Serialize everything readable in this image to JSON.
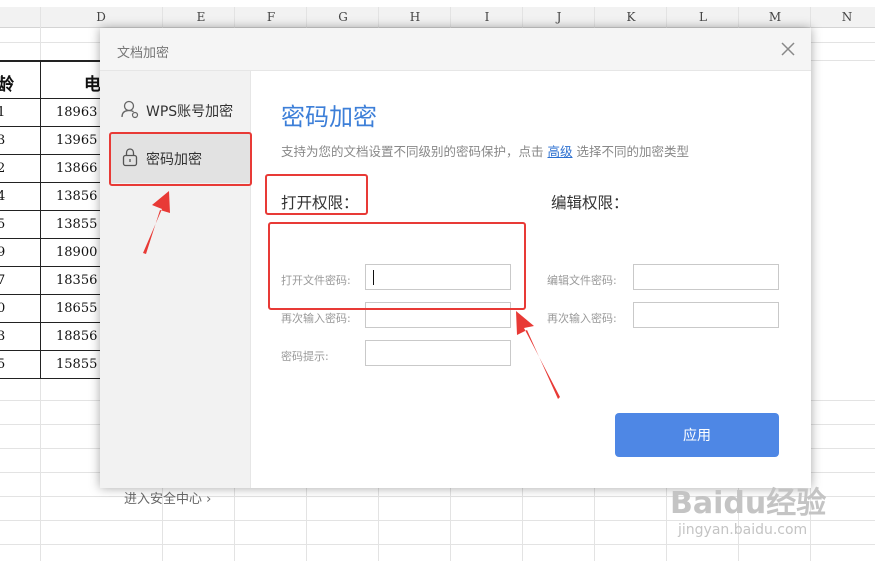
{
  "sheet": {
    "columns": [
      "D",
      "E",
      "F",
      "G",
      "H",
      "I",
      "J",
      "K",
      "L",
      "M",
      "N"
    ],
    "header_left": "龄",
    "header_d": "电",
    "rows": [
      {
        "c": "1",
        "d": "18963"
      },
      {
        "c": "3",
        "d": "13965"
      },
      {
        "c": "2",
        "d": "13866"
      },
      {
        "c": "4",
        "d": "13856"
      },
      {
        "c": "5",
        "d": "13855"
      },
      {
        "c": "9",
        "d": "18900"
      },
      {
        "c": "7",
        "d": "18356"
      },
      {
        "c": "0",
        "d": "18655"
      },
      {
        "c": "3",
        "d": "18856"
      },
      {
        "c": "5",
        "d": "15855"
      }
    ]
  },
  "dialog": {
    "title": "文档加密",
    "close_icon": "close-icon",
    "sidebar": {
      "items": [
        {
          "label": "WPS账号加密",
          "icon": "user-icon",
          "selected": false
        },
        {
          "label": "密码加密",
          "icon": "lock-icon",
          "selected": true
        }
      ],
      "security_center": "进入安全中心",
      "security_chevron": "›"
    },
    "main": {
      "heading": "密码加密",
      "desc_before": "支持为您的文档设置不同级别的密码保护，点击 ",
      "desc_link": "高级",
      "desc_after": " 选择不同的加密类型",
      "open_section": {
        "title": "打开权限：",
        "fields": [
          {
            "label": "打开文件密码:",
            "value": ""
          },
          {
            "label": "再次输入密码:",
            "value": ""
          },
          {
            "label": "密码提示:",
            "value": ""
          }
        ]
      },
      "edit_section": {
        "title": "编辑权限：",
        "fields": [
          {
            "label": "编辑文件密码:",
            "value": ""
          },
          {
            "label": "再次输入密码:",
            "value": ""
          }
        ]
      },
      "apply_label": "应用"
    }
  },
  "watermark": {
    "brand": "Baidu经验",
    "sub": "jingyan.baidu.com"
  },
  "colors": {
    "accent": "#3d7fd8",
    "apply_button": "#4e87e5",
    "annotation": "#e83a36"
  }
}
